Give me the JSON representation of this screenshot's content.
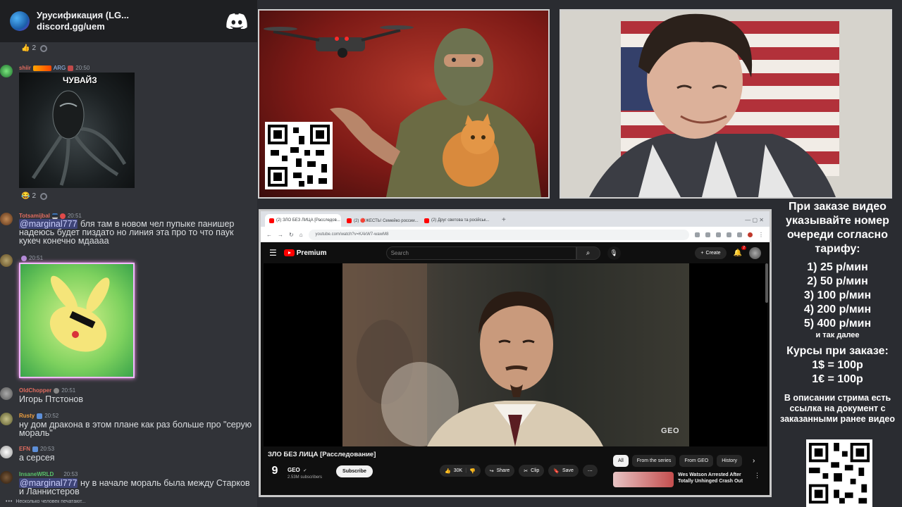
{
  "chat": {
    "server_title": "Урусификация (LG...",
    "server_invite": "discord.gg/uem",
    "reaction_top": {
      "emoji": "👍",
      "count": "2"
    },
    "reaction_mid": {
      "emoji": "😂",
      "count": "2"
    },
    "messages": [
      {
        "user": "shiir",
        "badge_text": "ARG",
        "time": "20:50",
        "image_caption": "ЧУВАЙЗ",
        "user_color": "#e06c5f"
      },
      {
        "user": "Totsamijbal",
        "time": "20:51",
        "text": "бля там в новом чел пупыке панишер надеюсь будет пиздато но линия эта про то что паук кукеч конечно мдаааа",
        "user_color": "#e06c5f"
      },
      {
        "user": "",
        "time": "20:51",
        "user_color": "#d3a4f5"
      },
      {
        "user": "OldChopper",
        "time": "20:51",
        "text": "Игорь Птстонов",
        "user_color": "#e06c5f"
      },
      {
        "user": "Rusty",
        "time": "20:52",
        "text": "ну дом дракона в этом плане как раз больше про \"серую мораль\"",
        "user_color": "#f0a040"
      },
      {
        "user": "EFN",
        "time": "20:53",
        "text": "а серсея",
        "user_color": "#e06c5f"
      },
      {
        "user": "InsaneWRLD",
        "time": "20:53",
        "mention": "@marginal777",
        "text": "ну в начале мораль была между Старков и Ланнистеров",
        "user_color": "#59c26a"
      }
    ],
    "mention_first": "@marginal777",
    "typing": "Несколько человек печатают..."
  },
  "browser": {
    "tabs": [
      {
        "label": "(2) ЗЛО БЕЗ ЛИЦА [Расследов...",
        "active": true
      },
      {
        "label": "(2) 🔴ЖЕСТЬ! Семейко россии...",
        "active": false
      },
      {
        "label": "(2) Друг светова та російськ...",
        "active": false
      }
    ],
    "new_tab": "+",
    "window_controls": "—  ▢  ✕",
    "url": "youtube.com/watch?v=KAkW7-wawM8"
  },
  "youtube": {
    "logo_text": "Premium",
    "search_placeholder": "Search",
    "create_label": "Create",
    "notif_count": "2",
    "video_watermark": "GEO",
    "video_title": "ЗЛО БЕЗ ЛИЦА [Расследование]",
    "channel_avatar": "9",
    "channel_name": "GEO",
    "channel_subs": "2.53M subscribers",
    "subscribe_label": "Subscribe",
    "likes": "30K",
    "share_label": "Share",
    "clip_label": "Clip",
    "save_label": "Save",
    "chips": [
      "All",
      "From the series",
      "From GEO",
      "History"
    ],
    "rec_title": "Wes Watson Arrested After Totally Unhinged Crash Out"
  },
  "info": {
    "header": "При заказе видео указывайте номер очереди согласно тарифу:",
    "tiers": [
      "1) 25 р/мин",
      "2) 50 р/мин",
      "3) 100 р/мин",
      "4) 200 р/мин",
      "5) 400 р/мин"
    ],
    "etc": "и так далее",
    "rates_title": "Курсы при заказе:",
    "rate_usd": "1$ = 100р",
    "rate_eur": "1€ = 100р",
    "note": "В описании стрима есть ссылка на документ с заказанными ранее видео"
  },
  "colors": {
    "discord_bg": "#313338",
    "yt_red": "#ff0000",
    "page_bg": "#2a2c31"
  }
}
